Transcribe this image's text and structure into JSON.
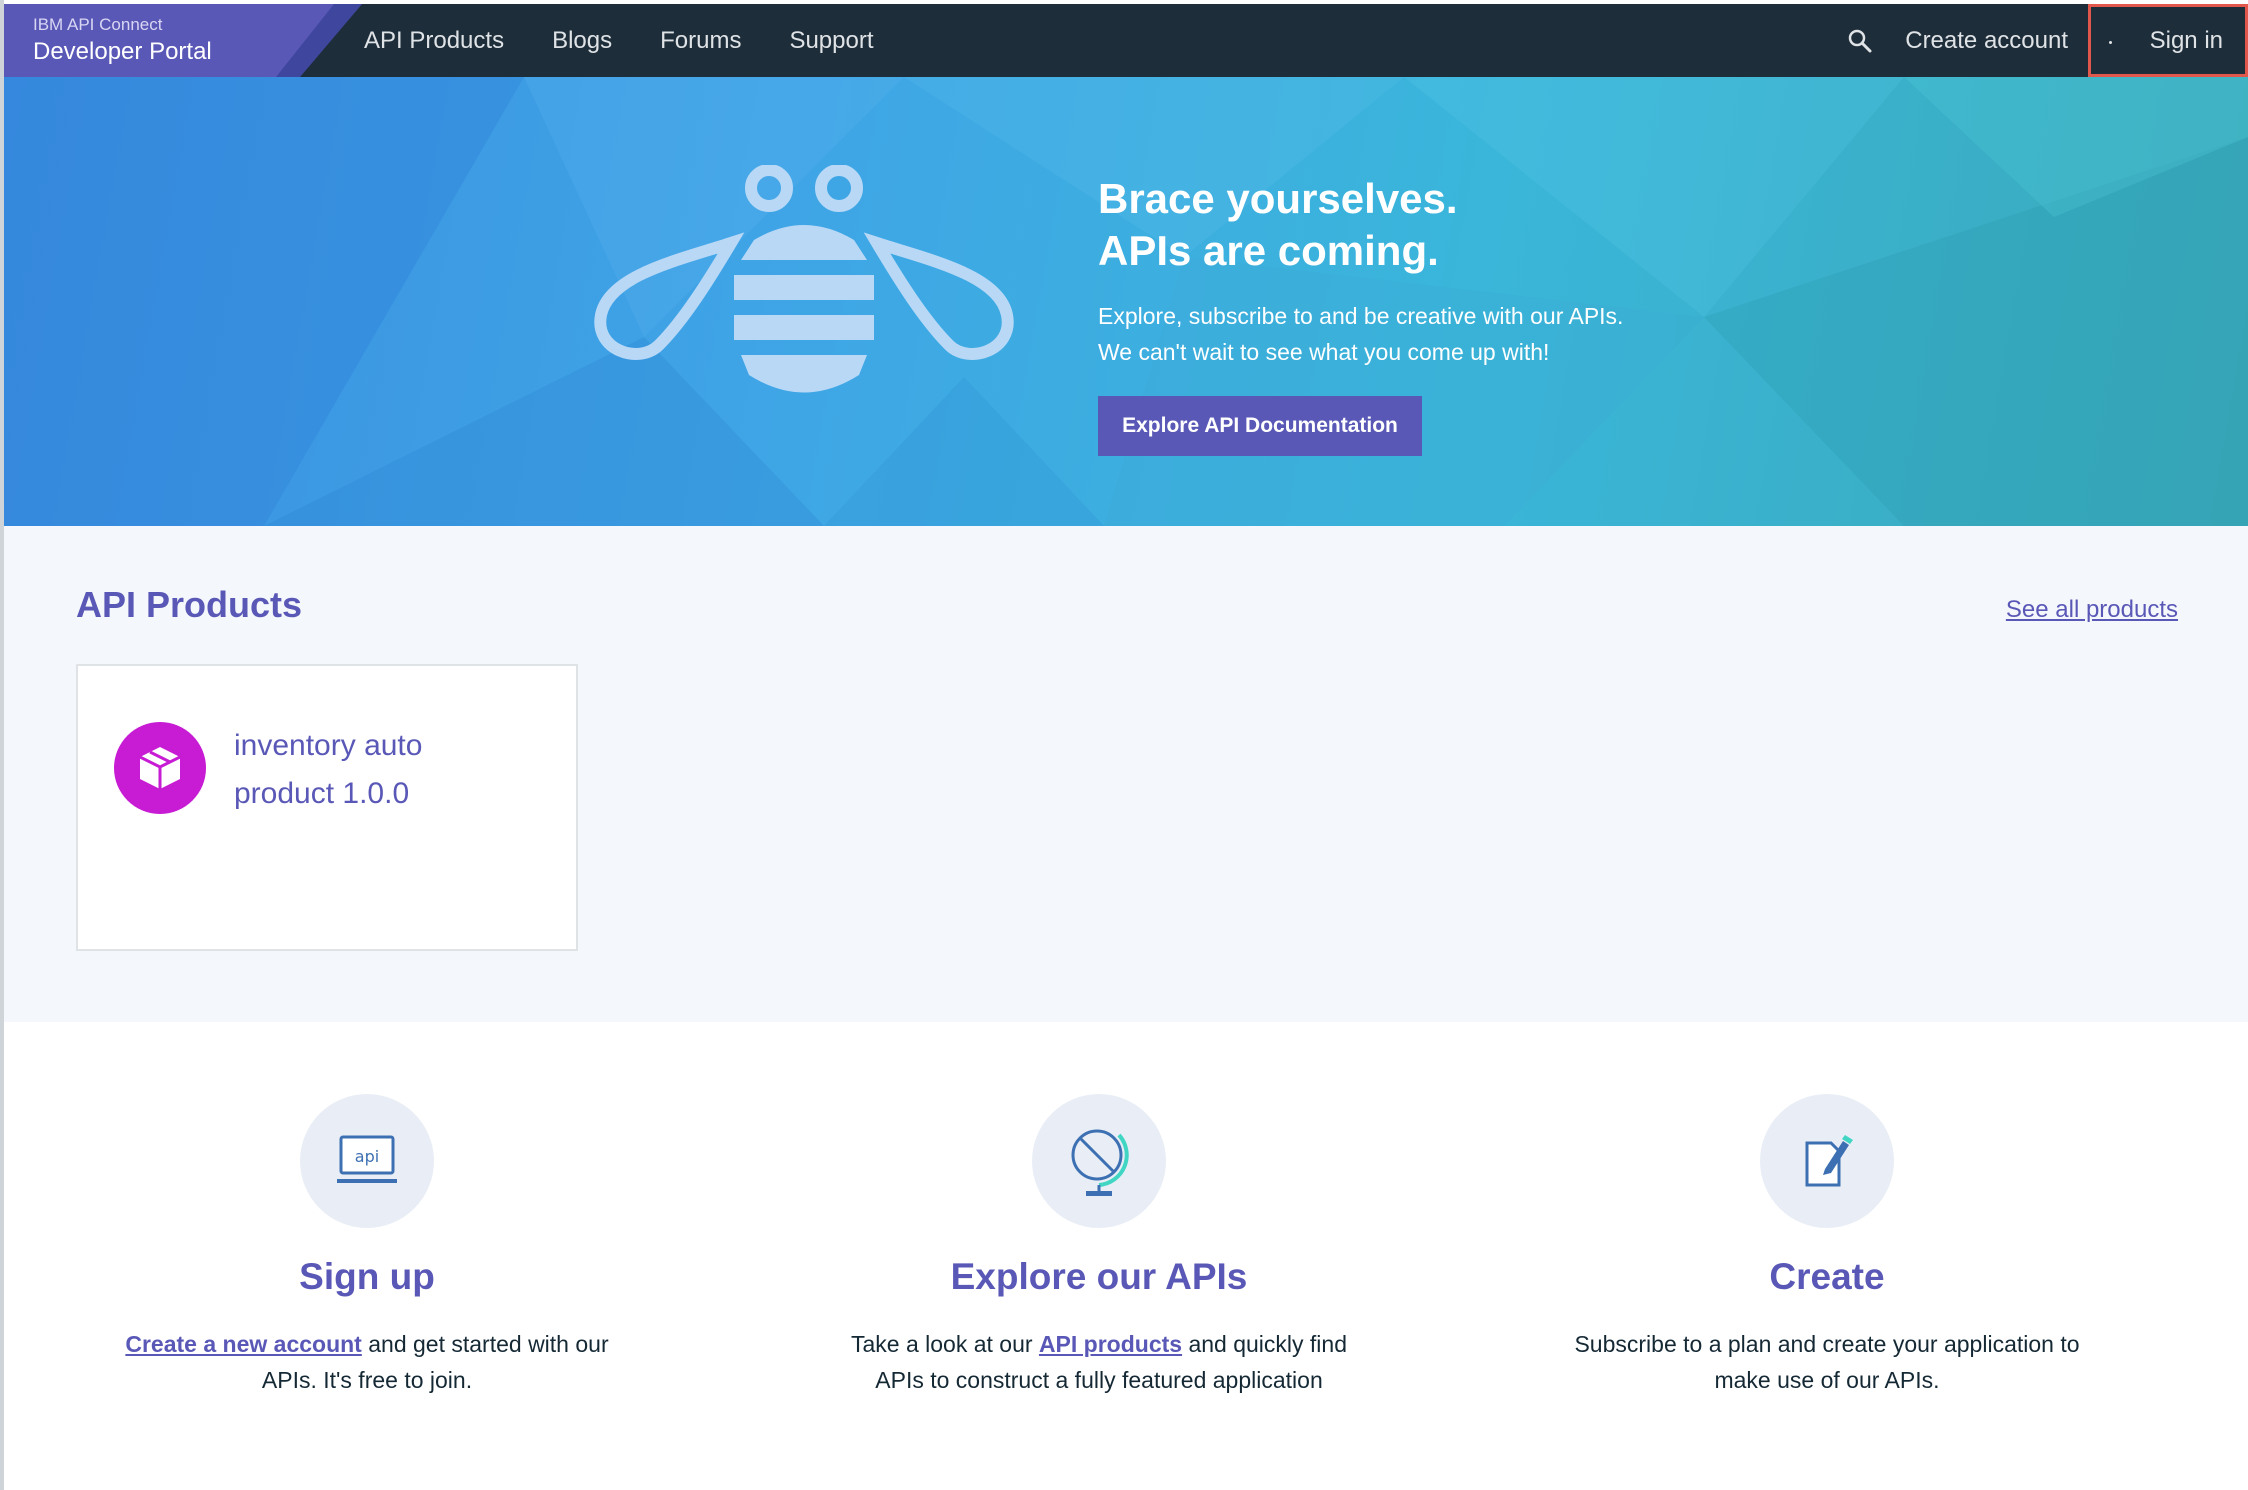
{
  "nav": {
    "brand_small": "IBM API Connect",
    "brand_big": "Developer Portal",
    "links": [
      "API Products",
      "Blogs",
      "Forums",
      "Support"
    ],
    "search_icon": "search-icon",
    "create_account": "Create account",
    "sign_in": "Sign in"
  },
  "hero": {
    "title_line1": "Brace yourselves.",
    "title_line2": "APIs are coming.",
    "sub_line1": "Explore, subscribe to and be creative with our APIs.",
    "sub_line2": "We can't wait to see what you come up with!",
    "button": "Explore API Documentation",
    "illustration": "bee-icon"
  },
  "products": {
    "title": "API Products",
    "see_all": "See all products",
    "items": [
      {
        "name_line1": "inventory auto",
        "name_line2": "product 1.0.0",
        "icon": "package-icon"
      }
    ]
  },
  "features": [
    {
      "icon": "api-laptop-icon",
      "title": "Sign up",
      "link": "Create a new account",
      "text_after_link": " and get started with our",
      "line2": "APIs. It's free to join."
    },
    {
      "icon": "globe-icon",
      "title": "Explore our APIs",
      "text_before_link": "Take a look at our ",
      "link": "API products",
      "text_after_link": " and quickly find",
      "line2": "APIs to construct a fully featured application"
    },
    {
      "icon": "document-edit-icon",
      "title": "Create",
      "line1": "Subscribe to a plan and create your application to",
      "line2": "make use of our APIs."
    }
  ],
  "colors": {
    "nav_bg": "#1e2d3a",
    "accent": "#5a58b7",
    "highlight_border": "#e2574c",
    "product_icon": "#c71bd4"
  }
}
